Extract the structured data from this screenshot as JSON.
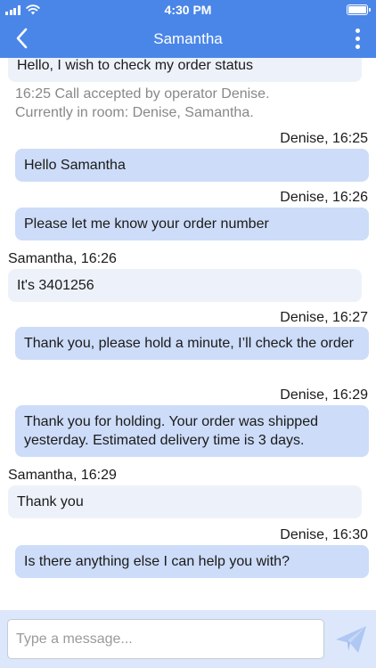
{
  "status_bar": {
    "time": "4:30 PM"
  },
  "header": {
    "title": "Samantha"
  },
  "messages": {
    "first_message_partial": "Hello, I wish to check my order status",
    "system_line1": "16:25 Call accepted by operator Denise.",
    "system_line2": "Currently in room: Denise, Samantha.",
    "items": [
      {
        "sender": "Denise, 16:25",
        "text": "Hello Samantha"
      },
      {
        "sender": "Denise, 16:26",
        "text": "Please let me know your order number"
      },
      {
        "sender": "Samantha, 16:26",
        "text": "It's 3401256"
      },
      {
        "sender": "Denise, 16:27",
        "text": "Thank you, please hold a minute, I’ll check the order"
      },
      {
        "sender": "Denise, 16:29",
        "text": "Thank you for holding. Your order was shipped yesterday. Estimated delivery time is 3 days."
      },
      {
        "sender": "Samantha, 16:29",
        "text": "Thank you"
      },
      {
        "sender": "Denise, 16:30",
        "text": "Is there anything else I can help you with?"
      }
    ]
  },
  "composer": {
    "placeholder": "Type a message...",
    "value": ""
  },
  "icons": {
    "back": "chevron-left-icon",
    "more": "more-vertical-icon",
    "send": "paper-plane-icon",
    "wifi": "wifi-icon",
    "signal": "cellular-signal-icon",
    "battery": "battery-icon"
  },
  "colors": {
    "header": "#4a86e8",
    "operator_bubble": "#cddcf8",
    "customer_bubble": "#edf2fa",
    "composer_bar": "#dde7fb",
    "system_text": "#888888"
  }
}
